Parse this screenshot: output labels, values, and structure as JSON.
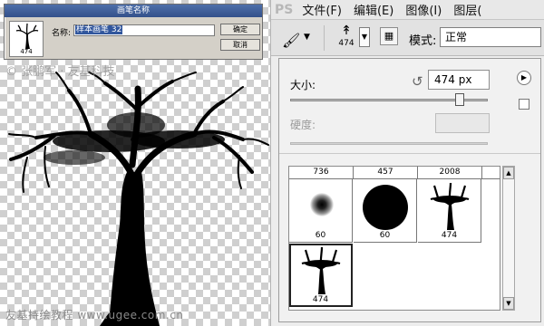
{
  "canvas": {
    "watermark_top": "© 张鹏军 · 友基科技",
    "watermark_bottom": "友基持绘教程 www.ugee.com.cn"
  },
  "brush_name_dialog": {
    "title": "画笔名称",
    "thumbnail_number": "474",
    "name_label": "名称:",
    "name_value": "样本画笔 32",
    "ok_label": "确定",
    "cancel_label": "取消"
  },
  "photoshop": {
    "logo": "PS",
    "menu": [
      {
        "label": "文件(F)"
      },
      {
        "label": "编辑(E)"
      },
      {
        "label": "图像(I)"
      },
      {
        "label": "图层("
      }
    ],
    "options_bar": {
      "brush_number": "474",
      "mode_label": "模式:",
      "mode_value": "正常"
    },
    "brush_popup": {
      "size_label": "大小:",
      "size_value": "474 px",
      "size_slider_fraction": 0.88,
      "hardness_label": "硬度:",
      "preset_header": [
        "736",
        "457",
        "2008"
      ],
      "presets": [
        {
          "type": "soft-round",
          "label": "60"
        },
        {
          "type": "hard-round",
          "label": "60"
        },
        {
          "type": "tree",
          "label": "474"
        },
        {
          "type": "tree",
          "label": "474",
          "selected": true
        }
      ]
    }
  },
  "icons": {
    "brush_tool": "brush-icon",
    "reset": "reset-icon",
    "flyout": "flyout-menu-icon",
    "new_preset": "new-preset-icon",
    "scroll_up": "scroll-up-icon",
    "scroll_down": "scroll-down-icon"
  }
}
